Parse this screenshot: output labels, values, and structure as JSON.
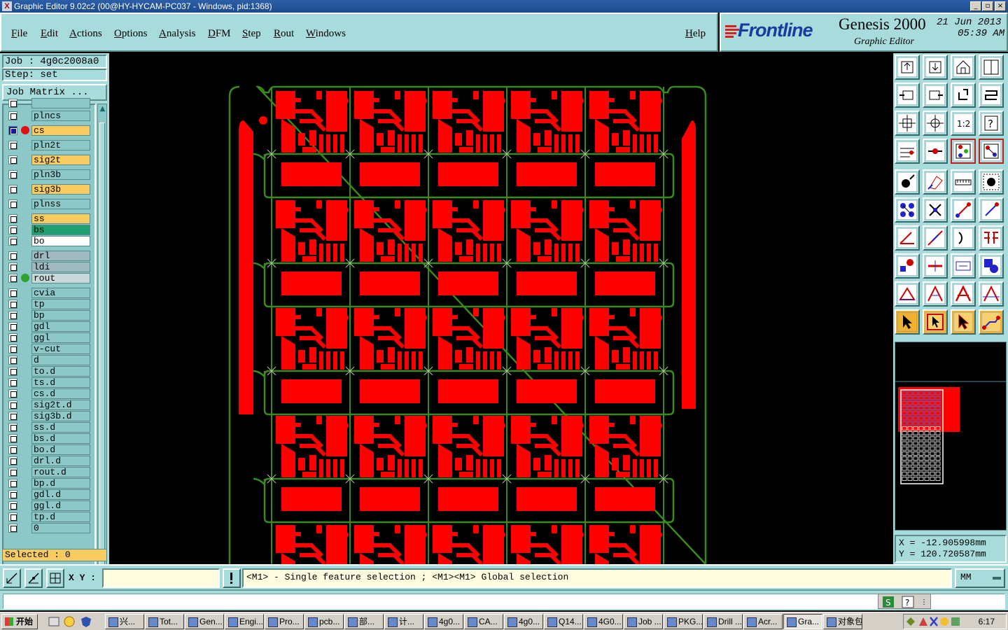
{
  "window": {
    "title": "Graphic Editor 9.02c2 (00@HY-HYCAM-PC037 - Windows, pid:1368)",
    "icon": "x-app-icon"
  },
  "menu": [
    {
      "label": "File"
    },
    {
      "label": "Edit"
    },
    {
      "label": "Actions"
    },
    {
      "label": "Options"
    },
    {
      "label": "Analysis"
    },
    {
      "label": "DFM"
    },
    {
      "label": "Step"
    },
    {
      "label": "Rout"
    },
    {
      "label": "Windows"
    }
  ],
  "help_label": "Help",
  "brand": {
    "logo": "Frontline",
    "product": "Genesis 2000",
    "module": "Graphic Editor",
    "date": "21 Jun 2013",
    "time": "05:39 AM"
  },
  "job": {
    "job_label": "Job : 4g0c2008a0",
    "step_label": "Step: set",
    "matrix_button": "Job Matrix ..."
  },
  "layers": [
    {
      "name": "plncs",
      "color": "#8cc8c8",
      "dot": ""
    },
    {
      "name": "cs",
      "color": "#f8cc60",
      "dot": "#e01010",
      "active": true
    },
    {
      "name": "pln2t",
      "color": "#8cc8c8",
      "dot": ""
    },
    {
      "name": "sig2t",
      "color": "#f8cc60",
      "dot": ""
    },
    {
      "name": "pln3b",
      "color": "#8cc8c8",
      "dot": ""
    },
    {
      "name": "sig3b",
      "color": "#f8cc60",
      "dot": ""
    },
    {
      "name": "plnss",
      "color": "#8cc8c8",
      "dot": ""
    },
    {
      "name": "ss",
      "color": "#f8cc60",
      "dot": ""
    },
    {
      "name": "bs",
      "color": "#20a070",
      "dot": ""
    },
    {
      "name": "bo",
      "color": "#ffffff",
      "dot": ""
    },
    {
      "name": "drl",
      "color": "#a0b8c0",
      "dot": ""
    },
    {
      "name": "ldi",
      "color": "#a0b8c0",
      "dot": ""
    },
    {
      "name": "rout",
      "color": "#c8d8d8",
      "dot": "#30a030"
    },
    {
      "name": "cvia",
      "color": "#8cc8c8",
      "dot": ""
    },
    {
      "name": "tp",
      "color": "#8cc8c8",
      "dot": ""
    },
    {
      "name": "bp",
      "color": "#8cc8c8",
      "dot": ""
    },
    {
      "name": "gdl",
      "color": "#8cc8c8",
      "dot": ""
    },
    {
      "name": "ggl",
      "color": "#8cc8c8",
      "dot": ""
    },
    {
      "name": "v-cut",
      "color": "#8cc8c8",
      "dot": ""
    },
    {
      "name": "d",
      "color": "#8cc8c8",
      "dot": ""
    },
    {
      "name": "to.d",
      "color": "#8cc8c8",
      "dot": ""
    },
    {
      "name": "ts.d",
      "color": "#8cc8c8",
      "dot": ""
    },
    {
      "name": "cs.d",
      "color": "#8cc8c8",
      "dot": ""
    },
    {
      "name": "sig2t.d",
      "color": "#8cc8c8",
      "dot": ""
    },
    {
      "name": "sig3b.d",
      "color": "#8cc8c8",
      "dot": ""
    },
    {
      "name": "ss.d",
      "color": "#8cc8c8",
      "dot": ""
    },
    {
      "name": "bs.d",
      "color": "#8cc8c8",
      "dot": ""
    },
    {
      "name": "bo.d",
      "color": "#8cc8c8",
      "dot": ""
    },
    {
      "name": "drl.d",
      "color": "#8cc8c8",
      "dot": ""
    },
    {
      "name": "rout.d",
      "color": "#8cc8c8",
      "dot": ""
    },
    {
      "name": "bp.d",
      "color": "#8cc8c8",
      "dot": ""
    },
    {
      "name": "gdl.d",
      "color": "#8cc8c8",
      "dot": ""
    },
    {
      "name": "ggl.d",
      "color": "#8cc8c8",
      "dot": ""
    },
    {
      "name": "tp.d",
      "color": "#8cc8c8",
      "dot": ""
    },
    {
      "name": "0",
      "color": "#8cc8c8",
      "dot": ""
    }
  ],
  "selected_label": "Selected : 0",
  "coords": {
    "x_label": "X = -12.905998mm",
    "y_label": "Y = 120.720587mm"
  },
  "input": {
    "xy_label": "X Y :",
    "value": "",
    "message": "<M1> - Single feature selection ; <M1><M1> Global selection",
    "unit": "MM"
  },
  "colors": {
    "copper": "#ff0000",
    "rout": "#3a8a1a",
    "panel_bg": "#a8dcdc"
  },
  "taskbar": {
    "start": "开始",
    "items": [
      "兴...",
      "Tot...",
      "Gen...",
      "Engi...",
      "Pro...",
      "pcb...",
      "部...",
      "计...",
      "4g0...",
      "CA...",
      "4g0...",
      "Q14...",
      "4G0...",
      "Job ...",
      "PKG...",
      "Drill ...",
      "Acr...",
      "Gra...",
      "对象包..."
    ],
    "clock": "6:17"
  }
}
